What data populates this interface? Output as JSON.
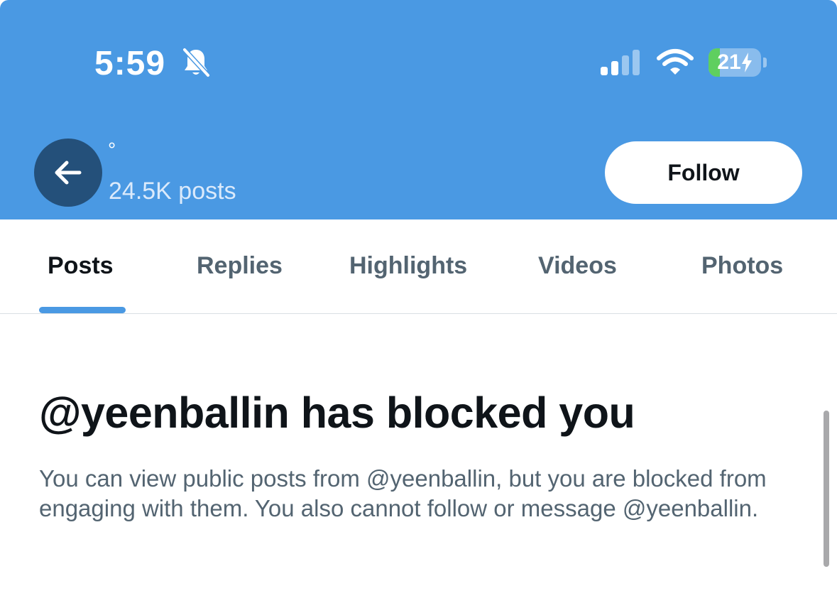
{
  "status_bar": {
    "time": "5:59",
    "battery_level": "21",
    "battery_fraction": 0.21,
    "icons": [
      "bell-slash-icon",
      "cellular-signal-icon",
      "wifi-icon",
      "battery-charging-icon"
    ]
  },
  "profile": {
    "name": "°",
    "post_count": "24.5K posts",
    "follow_label": "Follow",
    "back_icon": "arrow-left-icon"
  },
  "tabs": [
    {
      "label": "Posts",
      "active": true
    },
    {
      "label": "Replies",
      "active": false
    },
    {
      "label": "Highlights",
      "active": false
    },
    {
      "label": "Videos",
      "active": false
    },
    {
      "label": "Photos",
      "active": false
    }
  ],
  "blocked": {
    "title": "@yeenballin has blocked you",
    "description": "You can view public posts from @yeenballin, but you are blocked from engaging with them. You also cannot follow or message @yeenballin."
  },
  "colors": {
    "header_bg": "#4a99e3",
    "accent": "#4a99e3",
    "text_primary": "#0f1419",
    "text_secondary": "#536471"
  }
}
